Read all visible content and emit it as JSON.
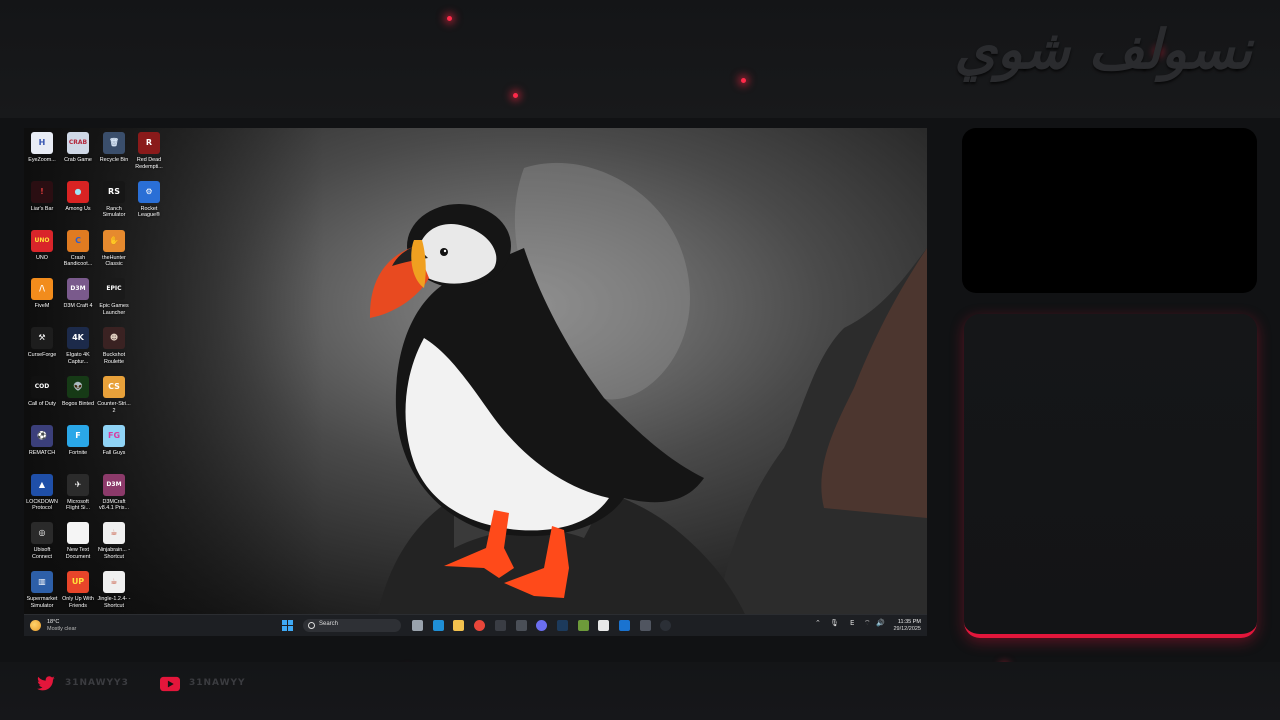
{
  "brand": {
    "title": "نسولف شوي"
  },
  "desktop_icons": [
    {
      "label": "EyeZoom...",
      "glyph": "H",
      "color": "#e8ecf5",
      "fg": "#3857b3"
    },
    {
      "label": "Crab Game",
      "glyph": "CRAB",
      "color": "#cfd8e6",
      "fg": "#b3263a"
    },
    {
      "label": "Recycle Bin",
      "glyph": "🗑",
      "color": "#3a4e6b",
      "fg": "#d6e4f5"
    },
    {
      "label": "Red Dead Redempti...",
      "glyph": "R",
      "color": "#8a1a1a",
      "fg": "#ffffff"
    },
    {
      "label": "Liar's Bar",
      "glyph": "!",
      "color": "#2a0e12",
      "fg": "#d93a3a"
    },
    {
      "label": "Among Us",
      "glyph": "●",
      "color": "#d92323",
      "fg": "#9fe3f5"
    },
    {
      "label": "Ranch Simulator",
      "glyph": "RS",
      "color": "#161616",
      "fg": "#ffffff"
    },
    {
      "label": "Rocket League®",
      "glyph": "⚙",
      "color": "#2a6fd6",
      "fg": "#ffffff"
    },
    {
      "label": "UNO",
      "glyph": "UNO",
      "color": "#d9252a",
      "fg": "#ffe13a"
    },
    {
      "label": "Crash Bandicoot...",
      "glyph": "C",
      "color": "#e07b21",
      "fg": "#2b5fd0"
    },
    {
      "label": "theHunter Classic",
      "glyph": "✋",
      "color": "#e68a2e",
      "fg": "#ffffff"
    },
    {
      "label": "FiveM",
      "glyph": "/\\",
      "color": "#f28c1c",
      "fg": "#ffffff"
    },
    {
      "label": "D3M Craft 4",
      "glyph": "D3M",
      "color": "#7a5a8c",
      "fg": "#ffffff"
    },
    {
      "label": "Epic Games Launcher",
      "glyph": "EPIC",
      "color": "#1a1a1a",
      "fg": "#ffffff"
    },
    {
      "label": "CurseForge",
      "glyph": "⚒",
      "color": "#1d1d1d",
      "fg": "#ffffff"
    },
    {
      "label": "Elgato 4K Captur...",
      "glyph": "4K",
      "color": "#1c2a4a",
      "fg": "#ffffff"
    },
    {
      "label": "Buckshot Roulette",
      "glyph": "☻",
      "color": "#3a2222",
      "fg": "#e0d0c0"
    },
    {
      "label": "Call of Duty",
      "glyph": "COD",
      "color": "#111111",
      "fg": "#ffffff"
    },
    {
      "label": "Bogos Binted",
      "glyph": "👽",
      "color": "#163a16",
      "fg": "#7ed957"
    },
    {
      "label": "Counter-Stri... 2",
      "glyph": "CS",
      "color": "#e8a13a",
      "fg": "#ffffff"
    },
    {
      "label": "REMATCH",
      "glyph": "⚽",
      "color": "#3b3f7a",
      "fg": "#ffffff"
    },
    {
      "label": "Fortnite",
      "glyph": "F",
      "color": "#2aa7e8",
      "fg": "#ffffff"
    },
    {
      "label": "Fall Guys",
      "glyph": "FG",
      "color": "#8fd3f5",
      "fg": "#d93aa0"
    },
    {
      "label": "LOCKDOWN Protocol",
      "glyph": "▲",
      "color": "#1f4fa8",
      "fg": "#ffffff"
    },
    {
      "label": "Microsoft Flight Si...",
      "glyph": "✈",
      "color": "#2b2b2b",
      "fg": "#ffffff"
    },
    {
      "label": "D3MCraft v8.4.1 Pris...",
      "glyph": "D3M",
      "color": "#8c3a6a",
      "fg": "#ffffff"
    },
    {
      "label": "Ubisoft Connect",
      "glyph": "◎",
      "color": "#2a2a2a",
      "fg": "#ffffff"
    },
    {
      "label": "New Text Document",
      "glyph": "",
      "color": "#f5f5f5",
      "fg": "#999999"
    },
    {
      "label": "Ninjabrain... - Shortcut",
      "glyph": "☕",
      "color": "#f0f0f0",
      "fg": "#c2462a"
    },
    {
      "label": "Supermarket Simulator",
      "glyph": "▥",
      "color": "#2d5fa8",
      "fg": "#ffffff"
    },
    {
      "label": "Only Up With Friends",
      "glyph": "UP",
      "color": "#e8452a",
      "fg": "#ffe13a"
    },
    {
      "label": "Jingle-1.2.4- - Shortcut",
      "glyph": "☕",
      "color": "#f0f0f0",
      "fg": "#c2462a"
    }
  ],
  "taskbar": {
    "weather_temp": "18°C",
    "weather_cond": "Mostly clear",
    "search_placeholder": "Search",
    "time": "11:35 PM",
    "date": "29/12/2025",
    "lang": "E",
    "apps": [
      {
        "name": "task-view",
        "color": "#9aa3ad"
      },
      {
        "name": "edge",
        "color": "#1f8fd6"
      },
      {
        "name": "file-explorer",
        "color": "#f2c14e"
      },
      {
        "name": "chrome",
        "color": "#e9463a"
      },
      {
        "name": "obs",
        "color": "#3a3d44"
      },
      {
        "name": "capture",
        "color": "#4a4f57"
      },
      {
        "name": "discord",
        "color": "#6b6ef0"
      },
      {
        "name": "steam",
        "color": "#1c3a5c"
      },
      {
        "name": "minecraft",
        "color": "#6d9a3a"
      },
      {
        "name": "capcut",
        "color": "#e8e8e8"
      },
      {
        "name": "outlook",
        "color": "#1a73d0"
      },
      {
        "name": "app-dark",
        "color": "#505560"
      },
      {
        "name": "elgato-4k",
        "color": "#2b2f36"
      }
    ]
  },
  "social": {
    "twitter_handle": "31NAWYY3",
    "youtube_handle": "31NAWYY",
    "accent": "#e3163b"
  }
}
